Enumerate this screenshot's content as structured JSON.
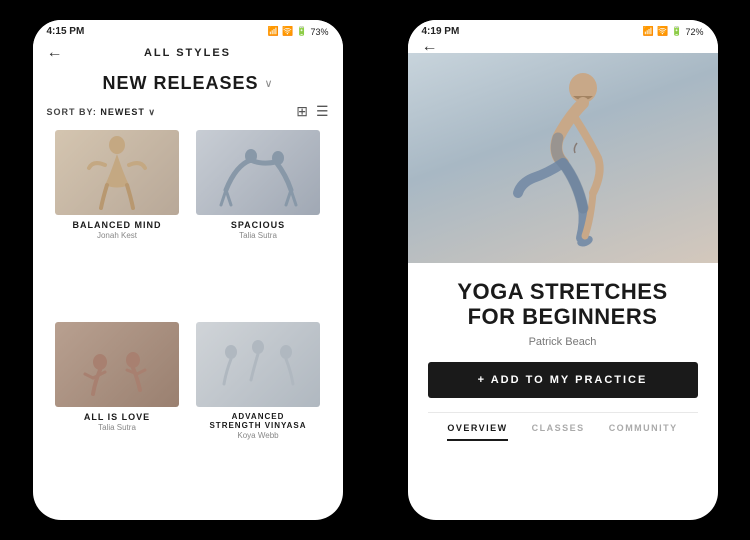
{
  "left_phone": {
    "status_bar": {
      "time": "4:15 PM",
      "battery": "73%",
      "signal": "📶"
    },
    "nav": {
      "back_label": "←",
      "title": "ALL STYLES"
    },
    "section": {
      "heading": "NEW RELEASES",
      "dropdown": "∨"
    },
    "sort": {
      "label": "SORT BY:",
      "value": "NEWEST",
      "chevron": "∨"
    },
    "grid_items": [
      {
        "title": "BALANCED MIND",
        "subtitle": "Jonah Kest",
        "thumb": "1"
      },
      {
        "title": "SPACIOUS",
        "subtitle": "Talia Sutra",
        "thumb": "2"
      },
      {
        "title": "ALL IS LOVE",
        "subtitle": "Talia Sutra",
        "thumb": "3"
      },
      {
        "title": "ADVANCED\nSTRENGTH VINYASA",
        "subtitle": "Koya Webb",
        "thumb": "4"
      },
      {
        "title": "",
        "subtitle": "",
        "thumb": "5"
      },
      {
        "title": "",
        "subtitle": "",
        "thumb": "6"
      }
    ]
  },
  "right_phone": {
    "status_bar": {
      "time": "4:19 PM",
      "battery": "72%"
    },
    "nav": {
      "back_label": "←"
    },
    "detail": {
      "title": "YOGA STRETCHES\nFOR BEGINNERS",
      "author": "Patrick Beach",
      "add_button": "+ ADD TO MY PRACTICE"
    },
    "tabs": [
      {
        "label": "OVERVIEW",
        "active": true
      },
      {
        "label": "CLASSES",
        "active": false
      },
      {
        "label": "COMMUNITY",
        "active": false
      }
    ]
  }
}
